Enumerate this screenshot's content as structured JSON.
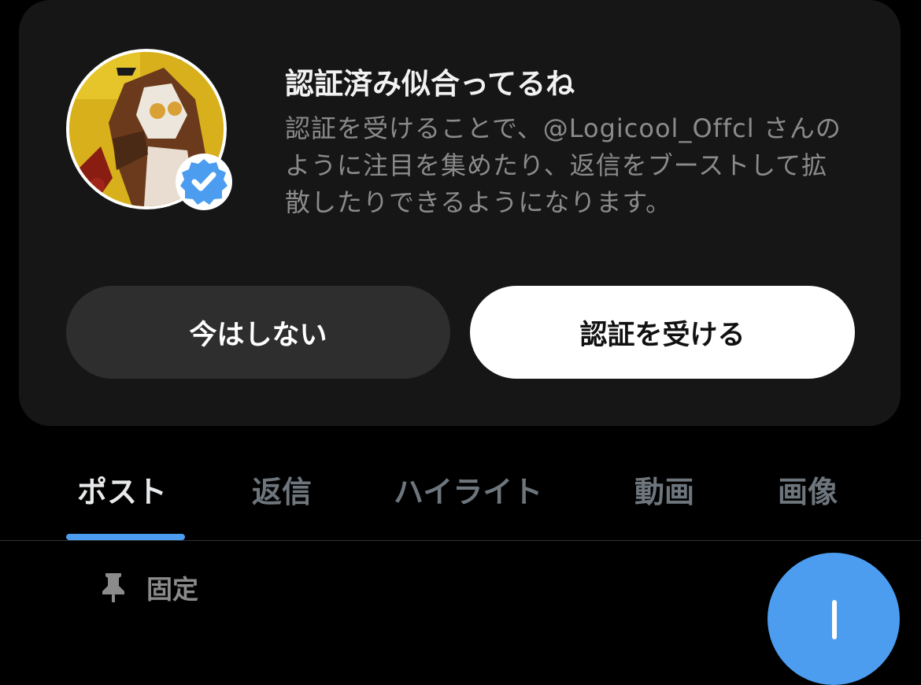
{
  "promo": {
    "title": "認証済み似合ってるね",
    "body": "認証を受けることで、@Logicool_Offcl さんのように注目を集めたり、返信をブーストして拡散したりできるようになります。",
    "not_now_label": "今はしない",
    "get_verified_label": "認証を受ける",
    "badge_color": "#4c9df0"
  },
  "tabs": {
    "items": [
      {
        "label": "ポスト",
        "active": true
      },
      {
        "label": "返信",
        "active": false
      },
      {
        "label": "ハイライト",
        "active": false
      },
      {
        "label": "動画",
        "active": false
      },
      {
        "label": "画像",
        "active": false
      }
    ],
    "indicator_color": "#4c9df0"
  },
  "pinned": {
    "label": "固定",
    "icon": "pin-icon"
  },
  "fab": {
    "icon": "plus-icon",
    "color": "#4c9df0"
  }
}
